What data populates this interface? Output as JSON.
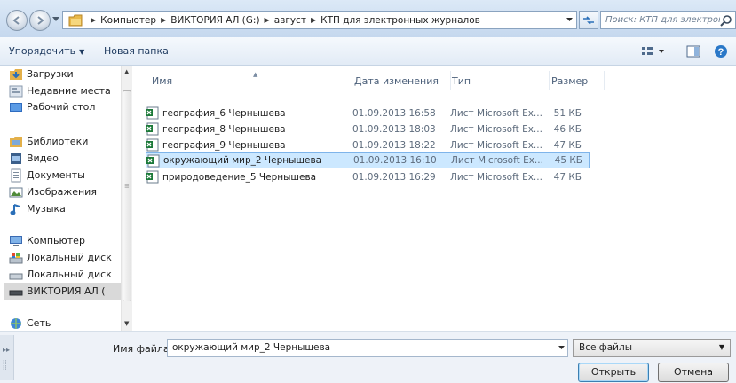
{
  "address": {
    "crumbs": [
      "Компьютер",
      "ВИКТОРИЯ АЛ (G:)",
      "август",
      "КТП для электронных журналов"
    ]
  },
  "search": {
    "placeholder": "Поиск: КТП для электронных..."
  },
  "toolbar": {
    "organize_label": "Упорядочить",
    "new_folder_label": "Новая папка"
  },
  "nav": {
    "items": [
      {
        "label": "Загрузки",
        "icon": "downloads-icon"
      },
      {
        "label": "Недавние места",
        "icon": "recent-places-icon"
      },
      {
        "label": "Рабочий стол",
        "icon": "desktop-icon"
      },
      {
        "label": "Библиотеки",
        "icon": "libraries-icon"
      },
      {
        "label": "Видео",
        "icon": "video-icon"
      },
      {
        "label": "Документы",
        "icon": "documents-icon"
      },
      {
        "label": "Изображения",
        "icon": "pictures-icon"
      },
      {
        "label": "Музыка",
        "icon": "music-icon"
      },
      {
        "label": "Компьютер",
        "icon": "computer-icon"
      },
      {
        "label": "Локальный диск",
        "icon": "local-disk-icon"
      },
      {
        "label": "Локальный диск",
        "icon": "local-disk-icon"
      },
      {
        "label": "ВИКТОРИЯ АЛ (",
        "icon": "removable-drive-icon"
      },
      {
        "label": "Сеть",
        "icon": "network-icon"
      }
    ]
  },
  "columns": {
    "name": "Имя",
    "date": "Дата изменения",
    "type": "Тип",
    "size": "Размер"
  },
  "files": [
    {
      "name": "география_6 Чернышева",
      "date": "01.09.2013 16:58",
      "type": "Лист Microsoft Ex...",
      "size": "51 КБ"
    },
    {
      "name": "география_8 Чернышева",
      "date": "01.09.2013 18:03",
      "type": "Лист Microsoft Ex...",
      "size": "46 КБ"
    },
    {
      "name": "география_9 Чернышева",
      "date": "01.09.2013 18:22",
      "type": "Лист Microsoft Ex...",
      "size": "47 КБ"
    },
    {
      "name": "окружающий мир_2 Чернышева",
      "date": "01.09.2013 16:10",
      "type": "Лист Microsoft Ex...",
      "size": "45 КБ"
    },
    {
      "name": "природоведение_5 Чернышева",
      "date": "01.09.2013 16:29",
      "type": "Лист Microsoft Ex...",
      "size": "47 КБ"
    }
  ],
  "bottom": {
    "file_name_label": "Имя файла:",
    "file_name_value": "окружающий мир_2 Чернышева",
    "file_type_value": "Все файлы",
    "open_label": "Открыть",
    "cancel_label": "Отмена"
  },
  "colors": {
    "selection": "#cce8ff",
    "selection_border": "#7eb4ea",
    "excel_green": "#1d7a3a"
  }
}
